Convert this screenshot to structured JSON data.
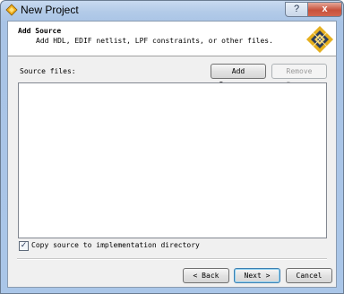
{
  "window": {
    "title": "New Project",
    "help_label": "?",
    "close_label": "x"
  },
  "header": {
    "title": "Add Source",
    "description": "Add HDL, EDIF netlist, LPF constraints, or other files."
  },
  "source_files": {
    "label": "Source files:",
    "add_button": "Add Source...",
    "remove_button": "Remove Source",
    "items": []
  },
  "options": {
    "copy_label": "Copy source to implementation directory",
    "copy_checked": true
  },
  "footer": {
    "back_label": "< Back",
    "next_label": "Next >",
    "cancel_label": "Cancel"
  },
  "icons": {
    "app": "lattice-diamond-icon",
    "wizard": "diamond-logo-icon"
  },
  "colors": {
    "title_bar": "#aac6e8",
    "logo_gold": "#e6b01e",
    "logo_dark": "#2d3d5a"
  }
}
